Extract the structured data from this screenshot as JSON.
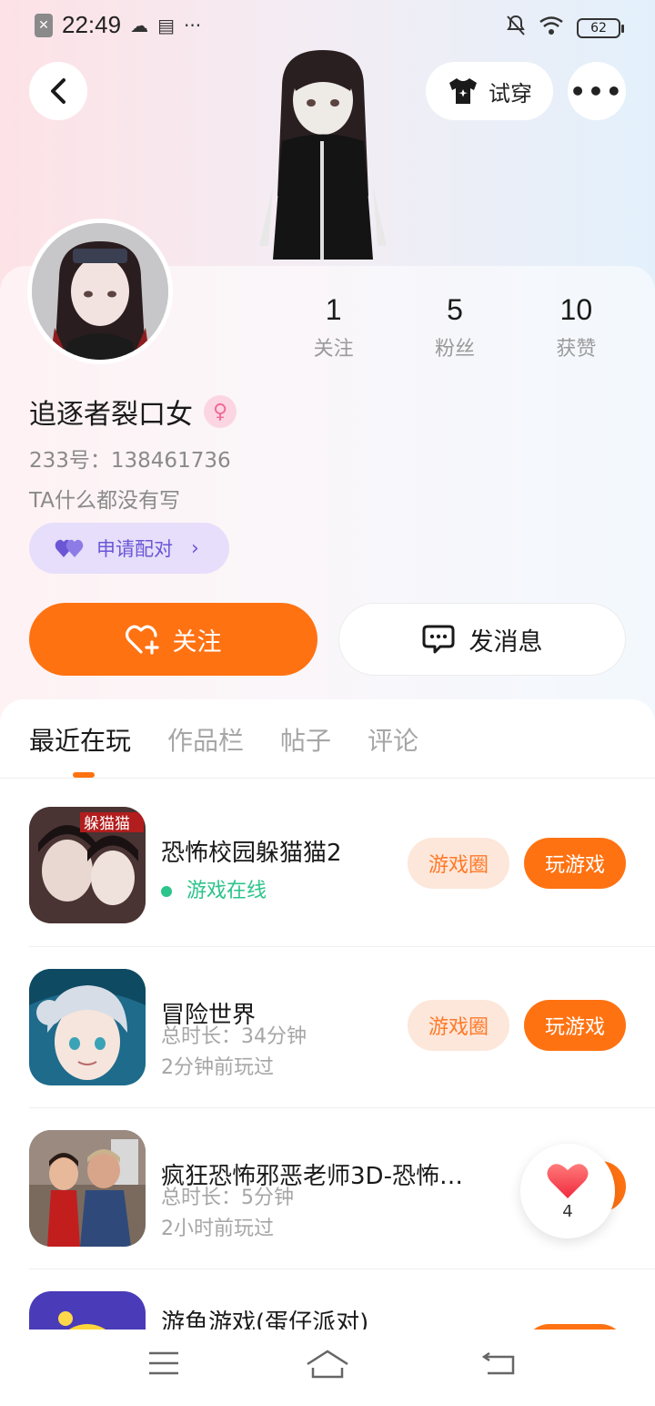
{
  "status_bar": {
    "time": "22:49",
    "battery": "62"
  },
  "header": {
    "tryon_label": "试穿"
  },
  "profile": {
    "stats": [
      {
        "num": "1",
        "label": "关注"
      },
      {
        "num": "5",
        "label": "粉丝"
      },
      {
        "num": "10",
        "label": "获赞"
      }
    ],
    "username": "追逐者裂口女",
    "uid": "233号：138461736",
    "bio": "TA什么都没有写",
    "match_label": "申请配对",
    "follow_label": "关注",
    "message_label": "发消息"
  },
  "tabs": [
    "最近在玩",
    "作品栏",
    "帖子",
    "评论"
  ],
  "games": [
    {
      "title": "恐怖校园躲猫猫2",
      "status": "游戏在线",
      "circle_label": "游戏圈",
      "play_label": "玩游戏"
    },
    {
      "title": "冒险世界",
      "duration": "总时长：34分钟",
      "last_played": "2分钟前玩过",
      "circle_label": "游戏圈",
      "play_label": "玩游戏"
    },
    {
      "title": "疯狂恐怖邪恶老师3D-恐怖…",
      "duration": "总时长：5分钟",
      "last_played": "2小时前玩过"
    },
    {
      "title": "游鱼游戏(蛋仔派对)"
    }
  ],
  "like_float": {
    "count": "4"
  },
  "colors": {
    "accent": "#ff7212",
    "online": "#2bc48a",
    "match": "#6b56d6"
  }
}
